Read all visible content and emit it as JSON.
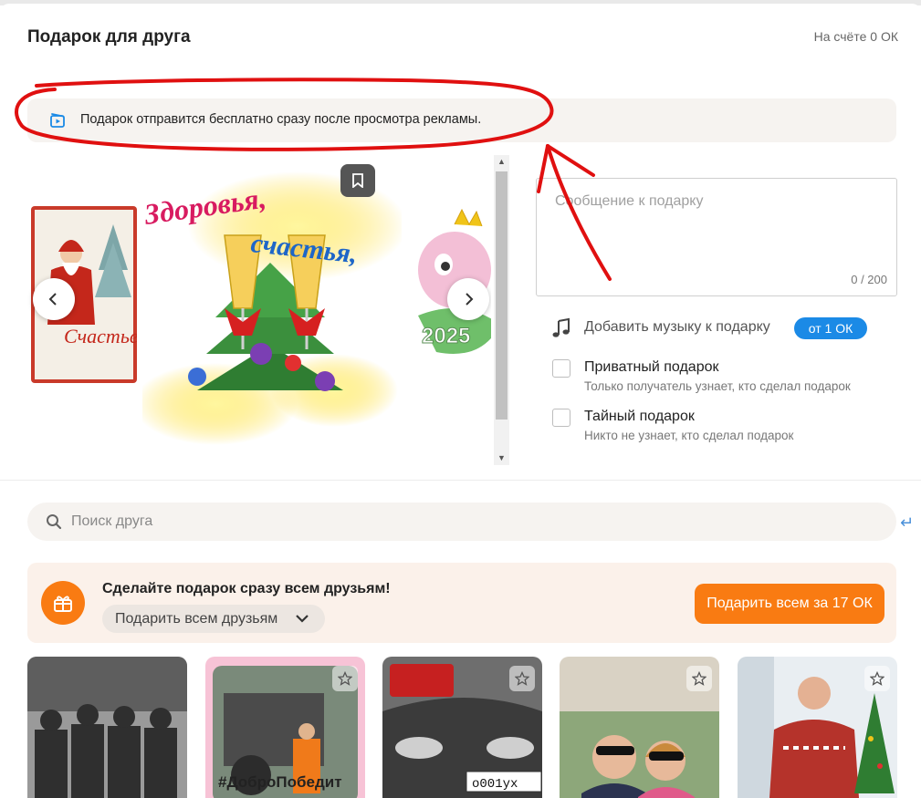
{
  "dialog": {
    "title": "Подарок для друга",
    "balance": "На счёте 0 ОК"
  },
  "notice": {
    "icon": "video-play-icon",
    "text": "Подарок отправится бесплатно сразу после просмотра рекламы."
  },
  "carousel": {
    "main_card_text_line1": "Здоровья,",
    "main_card_text_line2": "счастья,",
    "left_card_text": "Счастье",
    "right_card_text": "2025",
    "bookmark_icon": "bookmark-icon",
    "prev_icon": "chevron-left-icon",
    "next_icon": "chevron-right-icon"
  },
  "message": {
    "placeholder": "Сообщение к подарку",
    "counter": "0 / 200"
  },
  "music": {
    "label": "Добавить музыку к подарку",
    "badge": "от 1 ОК"
  },
  "options": [
    {
      "title": "Приватный подарок",
      "subtitle": "Только получатель узнает, кто сделал подарок"
    },
    {
      "title": "Тайный подарок",
      "subtitle": "Никто не узнает, кто сделал подарок"
    }
  ],
  "search": {
    "placeholder": "Поиск друга"
  },
  "promo": {
    "title": "Сделайте подарок сразу всем друзьям!",
    "dropdown_label": "Подарить всем друзьям",
    "button_label": "Подарить всем за 17 ОК"
  },
  "friends": [
    {
      "caption": ""
    },
    {
      "caption": "#ДоброПобедит"
    },
    {
      "caption": "о001ух"
    },
    {
      "caption": ""
    },
    {
      "caption": ""
    }
  ],
  "colors": {
    "accent_orange": "#f97b12",
    "badge_blue": "#1b8ae6",
    "annotation_red": "#e01010"
  }
}
